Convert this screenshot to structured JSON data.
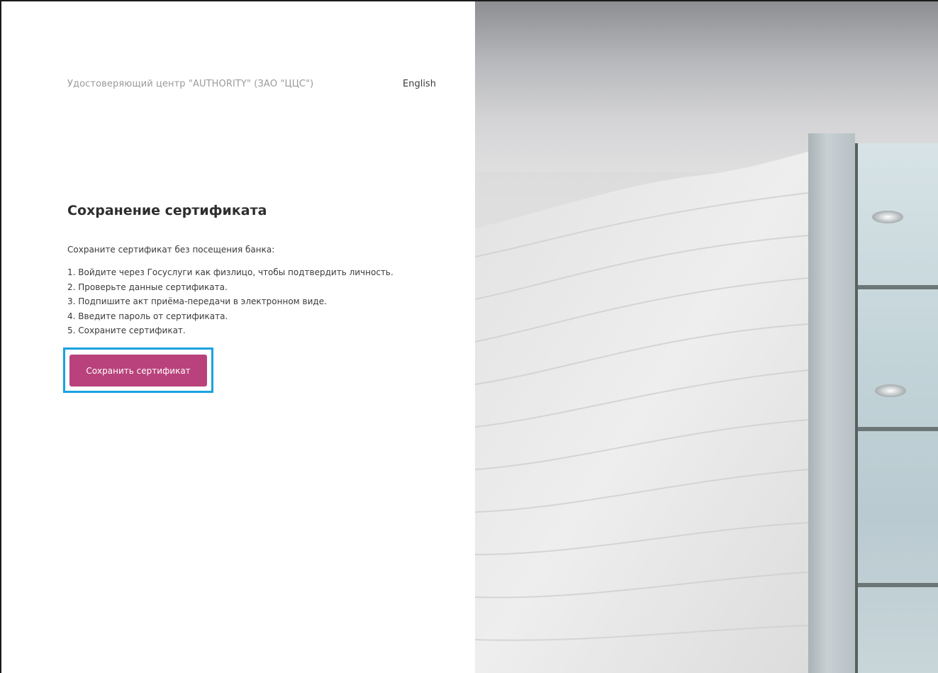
{
  "header": {
    "brand": "Удостоверяющий центр \"AUTHORITY\" (ЗАО \"ЦЦС\")",
    "language_link": "English"
  },
  "main": {
    "title": "Сохранение сертификата",
    "intro": "Сохраните сертификат без посещения банка:",
    "steps": [
      "1. Войдите через Госуслуги как физлицо, чтобы подтвердить личность.",
      "2. Проверьте данные сертификата.",
      "3. Подпишите акт приёма-передачи в электронном виде.",
      "4. Введите пароль от сертификата.",
      "5. Сохраните сертификат."
    ],
    "save_button_label": "Сохранить сертификат"
  },
  "colors": {
    "accent": "#b9427c",
    "focus_ring": "#1aa3e0"
  }
}
